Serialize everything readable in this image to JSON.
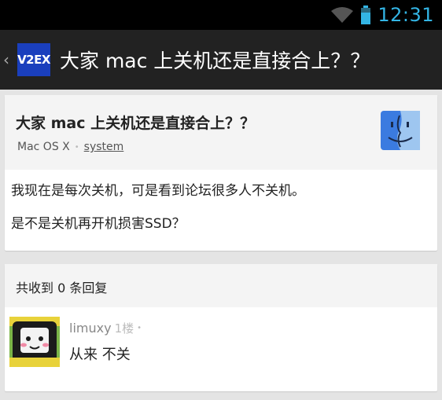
{
  "status_bar": {
    "time": "12:31",
    "accent": "#33b5e5",
    "icons": [
      "wifi-icon",
      "battery-icon"
    ]
  },
  "action_bar": {
    "logo_text": "V2EX",
    "title": "大家 mac 上关机还是直接合上？？",
    "background": "#222222"
  },
  "topic": {
    "title": "大家 mac 上关机还是直接合上？？",
    "node": "Mac OS X",
    "author": "system",
    "node_icon": "mac-finder-icon",
    "body": [
      "我现在是每次关机，可是看到论坛很多人不关机。",
      "是不是关机再开机损害SSD？"
    ]
  },
  "replies": {
    "count_label": "共收到 0 条回复",
    "items": [
      {
        "username": "limuxy",
        "floor": "1楼",
        "content": "从来 不关",
        "avatar_icon": "avatar-icon"
      }
    ]
  }
}
